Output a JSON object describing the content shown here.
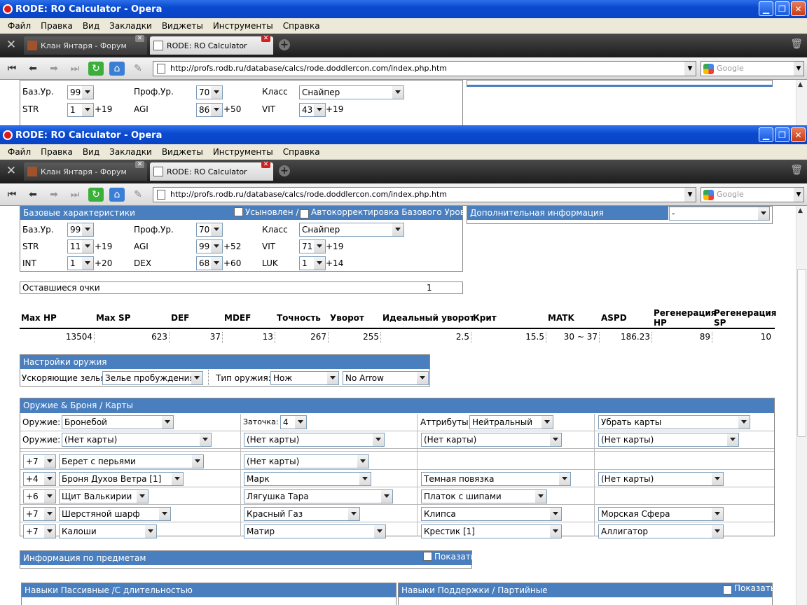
{
  "window": {
    "title": "RODE: RO Calculator - Opera"
  },
  "menu": [
    "Файл",
    "Правка",
    "Вид",
    "Закладки",
    "Виджеты",
    "Инструменты",
    "Справка"
  ],
  "tabs": [
    {
      "label": "Клан Янтаря - Форум"
    },
    {
      "label": "RODE: RO Calculator"
    }
  ],
  "address": {
    "url": "http://profs.rodb.ru/database/calcs/rode.doddlercon.com/index.php.htm",
    "search_placeholder": "Google"
  },
  "top_preview": {
    "base_level": {
      "label": "Баз.Ур.",
      "value": "99"
    },
    "job_level": {
      "label": "Проф.Ур.",
      "value": "70"
    },
    "class": {
      "label": "Класс",
      "value": "Снайпер"
    },
    "str": {
      "label": "STR",
      "value": "1",
      "bonus": "+19"
    },
    "agi": {
      "label": "AGI",
      "value": "86",
      "bonus": "+50"
    },
    "vit": {
      "label": "VIT",
      "value": "43",
      "bonus": "+19"
    }
  },
  "base_stats": {
    "title": "Базовые характеристики",
    "adopted": "Усыновлен /",
    "autocorrect": "Автокорректировка Базового Уровня",
    "base_level": {
      "label": "Баз.Ур.",
      "value": "99"
    },
    "job_level": {
      "label": "Проф.Ур.",
      "value": "70"
    },
    "class": {
      "label": "Класс",
      "value": "Снайпер"
    },
    "str": {
      "label": "STR",
      "value": "11",
      "bonus": "+19"
    },
    "agi": {
      "label": "AGI",
      "value": "99",
      "bonus": "+52"
    },
    "vit": {
      "label": "VIT",
      "value": "71",
      "bonus": "+19"
    },
    "int": {
      "label": "INT",
      "value": "1",
      "bonus": "+20"
    },
    "dex": {
      "label": "DEX",
      "value": "68",
      "bonus": "+60"
    },
    "luk": {
      "label": "LUK",
      "value": "1",
      "bonus": "+14"
    },
    "remaining_label": "Оставшиеся очки",
    "remaining_value": "1"
  },
  "extra_info": {
    "label": "Дополнительная информация",
    "value": "-"
  },
  "stats_table": {
    "headers": [
      "Max HP",
      "Max SP",
      "DEF",
      "MDEF",
      "Точность",
      "Уворот",
      "Идеальный уворот",
      "Крит",
      "MATK",
      "ASPD",
      "Регенерация HP",
      "Регенерация SP"
    ],
    "values": [
      "13504",
      "623",
      "37",
      "13",
      "267",
      "255",
      "2.5",
      "15.5",
      "30 ~ 37",
      "186.23",
      "89",
      "10"
    ]
  },
  "weapon_settings": {
    "title": "Настройки оружия",
    "potion_label": "Ускоряющие зелья:",
    "potion_value": "Зелье пробуждения",
    "type_label": "Тип оружия:",
    "type_value": "Нож",
    "arrow_value": "No Arrow"
  },
  "equipment": {
    "title": "Оружие & Броня / Карты",
    "weapon_label": "Оружие:",
    "weapon_value": "Бронебой",
    "refine_label": "Заточка:",
    "refine_value": "4",
    "attr_label": "Аттрибуты:",
    "attr_value": "Нейтральный",
    "remove_cards": "Убрать карты",
    "card_label": "Оружие:",
    "no_card": "(Нет карты)",
    "rows": [
      {
        "refine": "+7",
        "item": "Берет с перьями",
        "card": "(Нет карты)"
      },
      {
        "refine": "+4",
        "item": "Броня Духов Ветра [1]",
        "card": "Марк",
        "acc": "Темная повязка",
        "acc_card": "(Нет карты)"
      },
      {
        "refine": "+6",
        "item": "Щит Валькирии",
        "card": "Лягушка Тара",
        "acc": "Платок с шипами"
      },
      {
        "refine": "+7",
        "item": "Шерстяной шарф",
        "card": "Красный Газ",
        "acc": "Клипса",
        "acc_card": "Морская Сфера"
      },
      {
        "refine": "+7",
        "item": "Калоши",
        "card": "Матир",
        "acc": "Крестик [1]",
        "acc_card": "Аллигатор"
      }
    ]
  },
  "items_info": {
    "title": "Информация по предметам",
    "show": "Показать"
  },
  "skills_passive": {
    "title": "Навыки Пассивные /С длительностью"
  },
  "skills_support": {
    "title": "Навыки Поддержки / Партийные",
    "show": "Показать"
  }
}
